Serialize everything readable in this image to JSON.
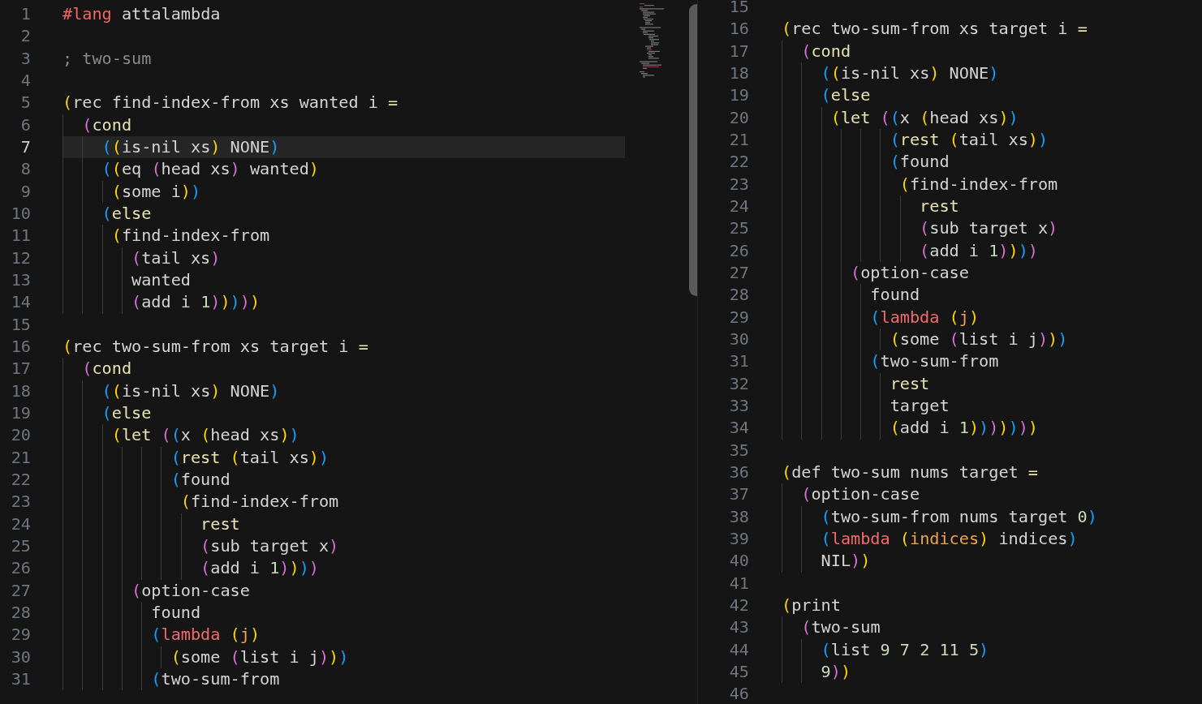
{
  "panes": [
    {
      "scrollbar": true,
      "lines": [
        {
          "number": "1",
          "current": false,
          "code": [
            {
              "kind": "directive",
              "text": "#lang"
            },
            {
              "kind": "plain",
              "text": " attalambda"
            }
          ]
        },
        {
          "number": "2",
          "current": false
        },
        {
          "number": "3",
          "current": false,
          "code": [
            {
              "kind": "comment",
              "text": "; two-sum"
            }
          ]
        },
        {
          "number": "4",
          "current": false
        },
        {
          "number": "5",
          "current": false,
          "code": [
            {
              "kind": "plain",
              "text": "(rec find-index-from xs wanted i "
            },
            {
              "kind": "keyword",
              "text": "="
            }
          ]
        },
        {
          "number": "6",
          "current": false,
          "code": [
            {
              "kind": "plain",
              "text": "  ("
            },
            {
              "kind": "keyword",
              "text": "cond"
            }
          ]
        },
        {
          "number": "7",
          "current": true,
          "code": [
            {
              "kind": "plain",
              "text": "    ((is-nil xs) NONE)"
            }
          ]
        },
        {
          "number": "8",
          "current": false,
          "code": [
            {
              "kind": "plain",
              "text": "    ((eq (head xs) wanted)"
            }
          ]
        },
        {
          "number": "9",
          "current": false,
          "code": [
            {
              "kind": "plain",
              "text": "     (some i))"
            }
          ]
        },
        {
          "number": "10",
          "current": false,
          "code": [
            {
              "kind": "plain",
              "text": "    ("
            },
            {
              "kind": "keyword",
              "text": "else"
            }
          ]
        },
        {
          "number": "11",
          "current": false,
          "code": [
            {
              "kind": "plain",
              "text": "     (find-index-from"
            }
          ]
        },
        {
          "number": "12",
          "current": false,
          "code": [
            {
              "kind": "plain",
              "text": "       (tail xs)"
            }
          ]
        },
        {
          "number": "13",
          "current": false,
          "code": [
            {
              "kind": "plain",
              "text": "       wanted"
            }
          ]
        },
        {
          "number": "14",
          "current": false,
          "code": [
            {
              "kind": "plain",
              "text": "       (add i "
            },
            {
              "kind": "number",
              "text": "1"
            },
            {
              "kind": "plain",
              "text": ")))))"
            }
          ]
        },
        {
          "number": "15",
          "current": false
        },
        {
          "number": "16",
          "current": false,
          "code": [
            {
              "kind": "plain",
              "text": "(rec two-sum-from xs target i "
            },
            {
              "kind": "keyword",
              "text": "="
            }
          ]
        },
        {
          "number": "17",
          "current": false,
          "code": [
            {
              "kind": "plain",
              "text": "  ("
            },
            {
              "kind": "keyword",
              "text": "cond"
            }
          ]
        },
        {
          "number": "18",
          "current": false,
          "code": [
            {
              "kind": "plain",
              "text": "    ((is-nil xs) NONE)"
            }
          ]
        },
        {
          "number": "19",
          "current": false,
          "code": [
            {
              "kind": "plain",
              "text": "    ("
            },
            {
              "kind": "keyword",
              "text": "else"
            }
          ]
        },
        {
          "number": "20",
          "current": false,
          "code": [
            {
              "kind": "plain",
              "text": "     ("
            },
            {
              "kind": "keyword",
              "text": "let"
            },
            {
              "kind": "plain",
              "text": " ((x (head xs))"
            }
          ]
        },
        {
          "number": "21",
          "current": false,
          "code": [
            {
              "kind": "plain",
              "text": "           ("
            },
            {
              "kind": "keyword",
              "text": "rest"
            },
            {
              "kind": "plain",
              "text": " (tail xs))"
            }
          ]
        },
        {
          "number": "22",
          "current": false,
          "code": [
            {
              "kind": "plain",
              "text": "           (found"
            }
          ]
        },
        {
          "number": "23",
          "current": false,
          "code": [
            {
              "kind": "plain",
              "text": "            (find-index-from"
            }
          ]
        },
        {
          "number": "24",
          "current": false,
          "code": [
            {
              "kind": "keyword",
              "text": "              rest"
            }
          ]
        },
        {
          "number": "25",
          "current": false,
          "code": [
            {
              "kind": "plain",
              "text": "              (sub target x)"
            }
          ]
        },
        {
          "number": "26",
          "current": false,
          "code": [
            {
              "kind": "plain",
              "text": "              (add i "
            },
            {
              "kind": "number",
              "text": "1"
            },
            {
              "kind": "plain",
              "text": "))))"
            }
          ]
        },
        {
          "number": "27",
          "current": false,
          "code": [
            {
              "kind": "plain",
              "text": "       (option-case"
            }
          ]
        },
        {
          "number": "28",
          "current": false,
          "code": [
            {
              "kind": "plain",
              "text": "         found"
            }
          ]
        },
        {
          "number": "29",
          "current": false,
          "code": [
            {
              "kind": "plain",
              "text": "         ("
            },
            {
              "kind": "lambda",
              "text": "lambda"
            },
            {
              "kind": "plain",
              "text": " ("
            },
            {
              "kind": "param",
              "text": "j"
            },
            {
              "kind": "plain",
              "text": ")"
            }
          ]
        },
        {
          "number": "30",
          "current": false,
          "code": [
            {
              "kind": "plain",
              "text": "           (some (list i j)))"
            }
          ]
        },
        {
          "number": "31",
          "current": false,
          "code": [
            {
              "kind": "plain",
              "text": "         (two-sum-from"
            }
          ]
        }
      ]
    },
    {
      "scrollbar": false,
      "lines": [
        {
          "number": "15",
          "current": false
        },
        {
          "number": "16",
          "current": false,
          "code": [
            {
              "kind": "plain",
              "text": "(rec two-sum-from xs target i "
            },
            {
              "kind": "keyword",
              "text": "="
            }
          ]
        },
        {
          "number": "17",
          "current": false,
          "code": [
            {
              "kind": "plain",
              "text": "  ("
            },
            {
              "kind": "keyword",
              "text": "cond"
            }
          ]
        },
        {
          "number": "18",
          "current": false,
          "code": [
            {
              "kind": "plain",
              "text": "    ((is-nil xs) NONE)"
            }
          ]
        },
        {
          "number": "19",
          "current": false,
          "code": [
            {
              "kind": "plain",
              "text": "    ("
            },
            {
              "kind": "keyword",
              "text": "else"
            }
          ]
        },
        {
          "number": "20",
          "current": false,
          "code": [
            {
              "kind": "plain",
              "text": "     ("
            },
            {
              "kind": "keyword",
              "text": "let"
            },
            {
              "kind": "plain",
              "text": " ((x (head xs))"
            }
          ]
        },
        {
          "number": "21",
          "current": false,
          "code": [
            {
              "kind": "plain",
              "text": "           ("
            },
            {
              "kind": "keyword",
              "text": "rest"
            },
            {
              "kind": "plain",
              "text": " (tail xs))"
            }
          ]
        },
        {
          "number": "22",
          "current": false,
          "code": [
            {
              "kind": "plain",
              "text": "           (found"
            }
          ]
        },
        {
          "number": "23",
          "current": false,
          "code": [
            {
              "kind": "plain",
              "text": "            (find-index-from"
            }
          ]
        },
        {
          "number": "24",
          "current": false,
          "code": [
            {
              "kind": "keyword",
              "text": "              rest"
            }
          ]
        },
        {
          "number": "25",
          "current": false,
          "code": [
            {
              "kind": "plain",
              "text": "              (sub target x)"
            }
          ]
        },
        {
          "number": "26",
          "current": false,
          "code": [
            {
              "kind": "plain",
              "text": "              (add i "
            },
            {
              "kind": "number",
              "text": "1"
            },
            {
              "kind": "plain",
              "text": "))))"
            }
          ]
        },
        {
          "number": "27",
          "current": false,
          "code": [
            {
              "kind": "plain",
              "text": "       (option-case"
            }
          ]
        },
        {
          "number": "28",
          "current": false,
          "code": [
            {
              "kind": "plain",
              "text": "         found"
            }
          ]
        },
        {
          "number": "29",
          "current": false,
          "code": [
            {
              "kind": "plain",
              "text": "         ("
            },
            {
              "kind": "lambda",
              "text": "lambda"
            },
            {
              "kind": "plain",
              "text": " ("
            },
            {
              "kind": "param",
              "text": "j"
            },
            {
              "kind": "plain",
              "text": ")"
            }
          ]
        },
        {
          "number": "30",
          "current": false,
          "code": [
            {
              "kind": "plain",
              "text": "           (some (list i j)))"
            }
          ]
        },
        {
          "number": "31",
          "current": false,
          "code": [
            {
              "kind": "plain",
              "text": "         (two-sum-from"
            }
          ]
        },
        {
          "number": "32",
          "current": false,
          "code": [
            {
              "kind": "keyword",
              "text": "           rest"
            }
          ]
        },
        {
          "number": "33",
          "current": false,
          "code": [
            {
              "kind": "plain",
              "text": "           target"
            }
          ]
        },
        {
          "number": "34",
          "current": false,
          "code": [
            {
              "kind": "plain",
              "text": "           (add i "
            },
            {
              "kind": "number",
              "text": "1"
            },
            {
              "kind": "plain",
              "text": ")))))))"
            }
          ]
        },
        {
          "number": "35",
          "current": false
        },
        {
          "number": "36",
          "current": false,
          "code": [
            {
              "kind": "plain",
              "text": "(def two-sum nums target "
            },
            {
              "kind": "keyword",
              "text": "="
            }
          ]
        },
        {
          "number": "37",
          "current": false,
          "code": [
            {
              "kind": "plain",
              "text": "  (option-case"
            }
          ]
        },
        {
          "number": "38",
          "current": false,
          "code": [
            {
              "kind": "plain",
              "text": "    (two-sum-from nums target "
            },
            {
              "kind": "number",
              "text": "0"
            },
            {
              "kind": "plain",
              "text": ")"
            }
          ]
        },
        {
          "number": "39",
          "current": false,
          "code": [
            {
              "kind": "plain",
              "text": "    ("
            },
            {
              "kind": "lambda",
              "text": "lambda"
            },
            {
              "kind": "plain",
              "text": " ("
            },
            {
              "kind": "param",
              "text": "indices"
            },
            {
              "kind": "plain",
              "text": ") indices)"
            }
          ]
        },
        {
          "number": "40",
          "current": false,
          "code": [
            {
              "kind": "plain",
              "text": "    NIL))"
            }
          ]
        },
        {
          "number": "41",
          "current": false
        },
        {
          "number": "42",
          "current": false,
          "code": [
            {
              "kind": "plain",
              "text": "(print"
            }
          ]
        },
        {
          "number": "43",
          "current": false,
          "code": [
            {
              "kind": "plain",
              "text": "  (two-sum"
            }
          ]
        },
        {
          "number": "44",
          "current": false,
          "code": [
            {
              "kind": "plain",
              "text": "    (list "
            },
            {
              "kind": "number",
              "text": "9 7 2 11 5"
            },
            {
              "kind": "plain",
              "text": ")"
            }
          ]
        },
        {
          "number": "45",
          "current": false,
          "code": [
            {
              "kind": "number",
              "text": "    9"
            },
            {
              "kind": "plain",
              "text": "))"
            }
          ]
        },
        {
          "number": "46",
          "current": false
        }
      ]
    }
  ]
}
